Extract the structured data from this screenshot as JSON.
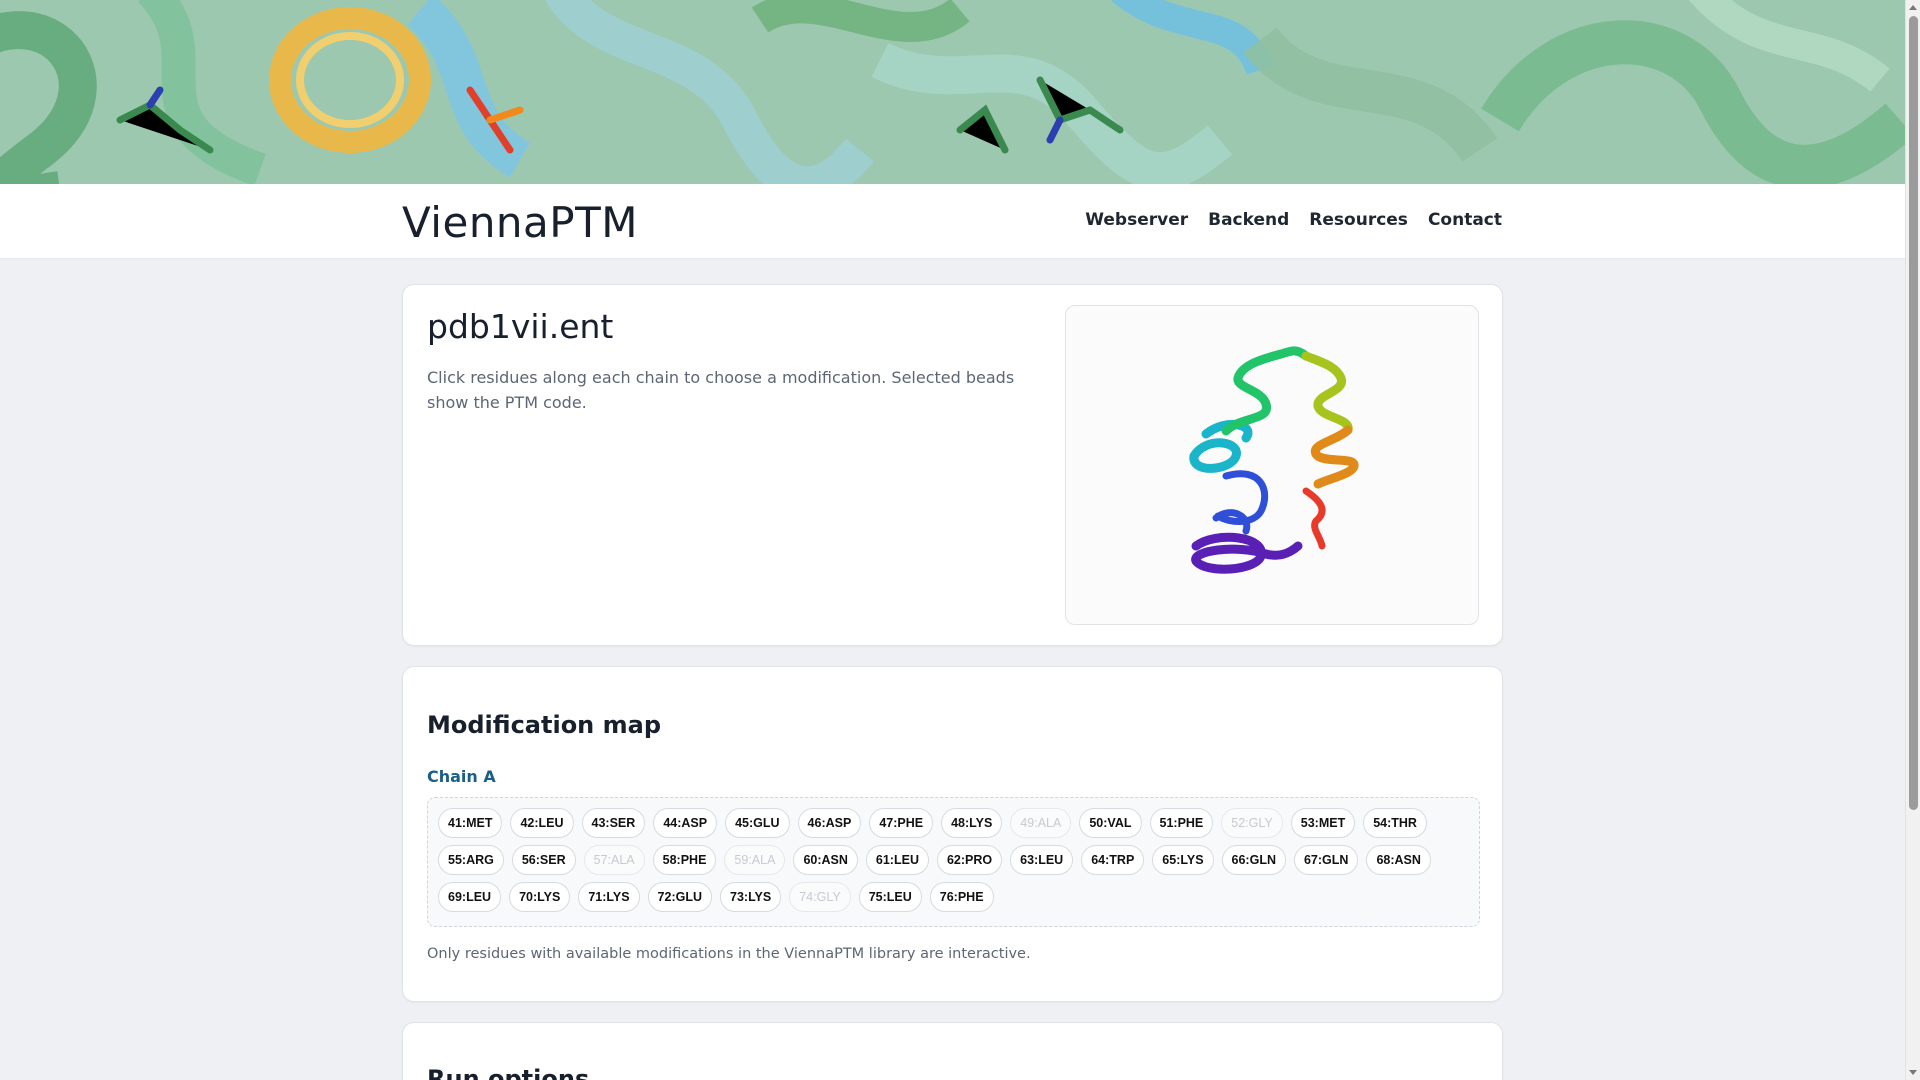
{
  "header": {
    "brand": "ViennaPTM",
    "nav": [
      "Webserver",
      "Backend",
      "Resources",
      "Contact"
    ]
  },
  "file_card": {
    "title": "pdb1vii.ent",
    "description": "Click residues along each chain to choose a modification. Selected beads show the PTM code."
  },
  "map_card": {
    "title": "Modification map",
    "chain_label": "Chain A",
    "residues": [
      [
        {
          "label": "41:MET",
          "enabled": true
        },
        {
          "label": "42:LEU",
          "enabled": true
        },
        {
          "label": "43:SER",
          "enabled": true
        },
        {
          "label": "44:ASP",
          "enabled": true
        },
        {
          "label": "45:GLU",
          "enabled": true
        },
        {
          "label": "46:ASP",
          "enabled": true
        },
        {
          "label": "47:PHE",
          "enabled": true
        },
        {
          "label": "48:LYS",
          "enabled": true
        },
        {
          "label": "49:ALA",
          "enabled": false
        },
        {
          "label": "50:VAL",
          "enabled": true
        },
        {
          "label": "51:PHE",
          "enabled": true
        },
        {
          "label": "52:GLY",
          "enabled": false
        },
        {
          "label": "53:MET",
          "enabled": true
        },
        {
          "label": "54:THR",
          "enabled": true
        }
      ],
      [
        {
          "label": "55:ARG",
          "enabled": true
        },
        {
          "label": "56:SER",
          "enabled": true
        },
        {
          "label": "57:ALA",
          "enabled": false
        },
        {
          "label": "58:PHE",
          "enabled": true
        },
        {
          "label": "59:ALA",
          "enabled": false
        },
        {
          "label": "60:ASN",
          "enabled": true
        },
        {
          "label": "61:LEU",
          "enabled": true
        },
        {
          "label": "62:PRO",
          "enabled": true
        },
        {
          "label": "63:LEU",
          "enabled": true
        },
        {
          "label": "64:TRP",
          "enabled": true
        },
        {
          "label": "65:LYS",
          "enabled": true
        },
        {
          "label": "66:GLN",
          "enabled": true
        },
        {
          "label": "67:GLN",
          "enabled": true
        },
        {
          "label": "68:ASN",
          "enabled": true
        }
      ],
      [
        {
          "label": "69:LEU",
          "enabled": true
        },
        {
          "label": "70:LYS",
          "enabled": true
        },
        {
          "label": "71:LYS",
          "enabled": true
        },
        {
          "label": "72:GLU",
          "enabled": true
        },
        {
          "label": "73:LYS",
          "enabled": true
        },
        {
          "label": "74:GLY",
          "enabled": false
        },
        {
          "label": "75:LEU",
          "enabled": true
        },
        {
          "label": "76:PHE",
          "enabled": true
        }
      ]
    ],
    "note": "Only residues with available modifications in the ViennaPTM library are interactive."
  },
  "run_card": {
    "title": "Run options"
  },
  "colors": {
    "accent": "#1b5e86",
    "banner_green": "#7fb396",
    "banner_blue": "#8fc3dc",
    "banner_yellow": "#e8b94a"
  }
}
